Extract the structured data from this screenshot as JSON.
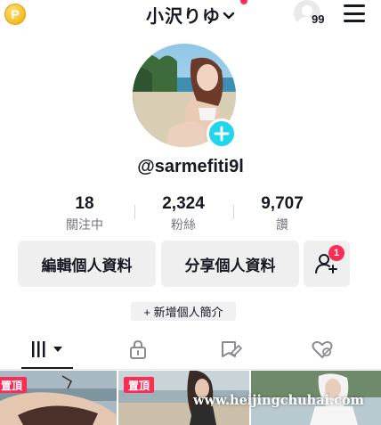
{
  "header": {
    "username": "小沢りゆ",
    "visitor_count": "99",
    "icons": {
      "coin": "coin-icon",
      "chevron": "chevron-down-icon",
      "visitors": "profile-visitors-icon",
      "menu": "hamburger-menu-icon"
    },
    "coin_glyph": "P"
  },
  "profile": {
    "handle": "@sarmefiti9l",
    "avatar_icon": "profile-photo",
    "add_icon": "plus-icon"
  },
  "stats": [
    {
      "value": "18",
      "label": "關注中"
    },
    {
      "value": "2,324",
      "label": "粉絲"
    },
    {
      "value": "9,707",
      "label": "讚"
    }
  ],
  "actions": {
    "edit_profile": "編輯個人資料",
    "share_profile": "分享個人資料",
    "add_friends_badge": "1",
    "add_bio": "+ 新增個人簡介"
  },
  "tabs": [
    {
      "icon": "videos-grid-icon",
      "active": true
    },
    {
      "icon": "lock-icon",
      "active": false
    },
    {
      "icon": "favorites-icon",
      "active": false
    },
    {
      "icon": "liked-heart-icon",
      "active": false
    }
  ],
  "videos": [
    {
      "pinned_label": "置頂"
    },
    {
      "pinned_label": "置頂"
    },
    {
      "pinned_label": ""
    }
  ],
  "watermark": "www.heijingchuhai.com",
  "colors": {
    "accent_cyan": "#20d5ec",
    "accent_red": "#fe2c55",
    "button_bg": "#efeff0",
    "text": "#161823",
    "muted": "#75767c"
  }
}
